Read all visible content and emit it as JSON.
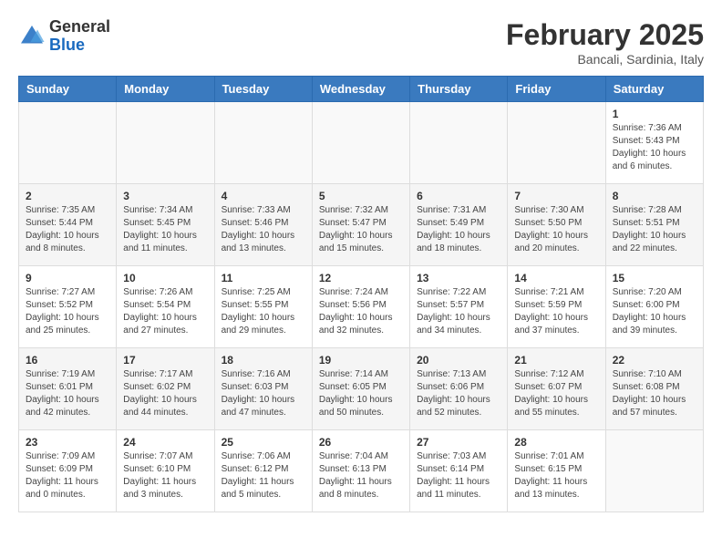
{
  "header": {
    "logo_general": "General",
    "logo_blue": "Blue",
    "title": "February 2025",
    "subtitle": "Bancali, Sardinia, Italy"
  },
  "weekdays": [
    "Sunday",
    "Monday",
    "Tuesday",
    "Wednesday",
    "Thursday",
    "Friday",
    "Saturday"
  ],
  "weeks": [
    [
      {
        "day": "",
        "info": ""
      },
      {
        "day": "",
        "info": ""
      },
      {
        "day": "",
        "info": ""
      },
      {
        "day": "",
        "info": ""
      },
      {
        "day": "",
        "info": ""
      },
      {
        "day": "",
        "info": ""
      },
      {
        "day": "1",
        "info": "Sunrise: 7:36 AM\nSunset: 5:43 PM\nDaylight: 10 hours and 6 minutes."
      }
    ],
    [
      {
        "day": "2",
        "info": "Sunrise: 7:35 AM\nSunset: 5:44 PM\nDaylight: 10 hours and 8 minutes."
      },
      {
        "day": "3",
        "info": "Sunrise: 7:34 AM\nSunset: 5:45 PM\nDaylight: 10 hours and 11 minutes."
      },
      {
        "day": "4",
        "info": "Sunrise: 7:33 AM\nSunset: 5:46 PM\nDaylight: 10 hours and 13 minutes."
      },
      {
        "day": "5",
        "info": "Sunrise: 7:32 AM\nSunset: 5:47 PM\nDaylight: 10 hours and 15 minutes."
      },
      {
        "day": "6",
        "info": "Sunrise: 7:31 AM\nSunset: 5:49 PM\nDaylight: 10 hours and 18 minutes."
      },
      {
        "day": "7",
        "info": "Sunrise: 7:30 AM\nSunset: 5:50 PM\nDaylight: 10 hours and 20 minutes."
      },
      {
        "day": "8",
        "info": "Sunrise: 7:28 AM\nSunset: 5:51 PM\nDaylight: 10 hours and 22 minutes."
      }
    ],
    [
      {
        "day": "9",
        "info": "Sunrise: 7:27 AM\nSunset: 5:52 PM\nDaylight: 10 hours and 25 minutes."
      },
      {
        "day": "10",
        "info": "Sunrise: 7:26 AM\nSunset: 5:54 PM\nDaylight: 10 hours and 27 minutes."
      },
      {
        "day": "11",
        "info": "Sunrise: 7:25 AM\nSunset: 5:55 PM\nDaylight: 10 hours and 29 minutes."
      },
      {
        "day": "12",
        "info": "Sunrise: 7:24 AM\nSunset: 5:56 PM\nDaylight: 10 hours and 32 minutes."
      },
      {
        "day": "13",
        "info": "Sunrise: 7:22 AM\nSunset: 5:57 PM\nDaylight: 10 hours and 34 minutes."
      },
      {
        "day": "14",
        "info": "Sunrise: 7:21 AM\nSunset: 5:59 PM\nDaylight: 10 hours and 37 minutes."
      },
      {
        "day": "15",
        "info": "Sunrise: 7:20 AM\nSunset: 6:00 PM\nDaylight: 10 hours and 39 minutes."
      }
    ],
    [
      {
        "day": "16",
        "info": "Sunrise: 7:19 AM\nSunset: 6:01 PM\nDaylight: 10 hours and 42 minutes."
      },
      {
        "day": "17",
        "info": "Sunrise: 7:17 AM\nSunset: 6:02 PM\nDaylight: 10 hours and 44 minutes."
      },
      {
        "day": "18",
        "info": "Sunrise: 7:16 AM\nSunset: 6:03 PM\nDaylight: 10 hours and 47 minutes."
      },
      {
        "day": "19",
        "info": "Sunrise: 7:14 AM\nSunset: 6:05 PM\nDaylight: 10 hours and 50 minutes."
      },
      {
        "day": "20",
        "info": "Sunrise: 7:13 AM\nSunset: 6:06 PM\nDaylight: 10 hours and 52 minutes."
      },
      {
        "day": "21",
        "info": "Sunrise: 7:12 AM\nSunset: 6:07 PM\nDaylight: 10 hours and 55 minutes."
      },
      {
        "day": "22",
        "info": "Sunrise: 7:10 AM\nSunset: 6:08 PM\nDaylight: 10 hours and 57 minutes."
      }
    ],
    [
      {
        "day": "23",
        "info": "Sunrise: 7:09 AM\nSunset: 6:09 PM\nDaylight: 11 hours and 0 minutes."
      },
      {
        "day": "24",
        "info": "Sunrise: 7:07 AM\nSunset: 6:10 PM\nDaylight: 11 hours and 3 minutes."
      },
      {
        "day": "25",
        "info": "Sunrise: 7:06 AM\nSunset: 6:12 PM\nDaylight: 11 hours and 5 minutes."
      },
      {
        "day": "26",
        "info": "Sunrise: 7:04 AM\nSunset: 6:13 PM\nDaylight: 11 hours and 8 minutes."
      },
      {
        "day": "27",
        "info": "Sunrise: 7:03 AM\nSunset: 6:14 PM\nDaylight: 11 hours and 11 minutes."
      },
      {
        "day": "28",
        "info": "Sunrise: 7:01 AM\nSunset: 6:15 PM\nDaylight: 11 hours and 13 minutes."
      },
      {
        "day": "",
        "info": ""
      }
    ]
  ]
}
